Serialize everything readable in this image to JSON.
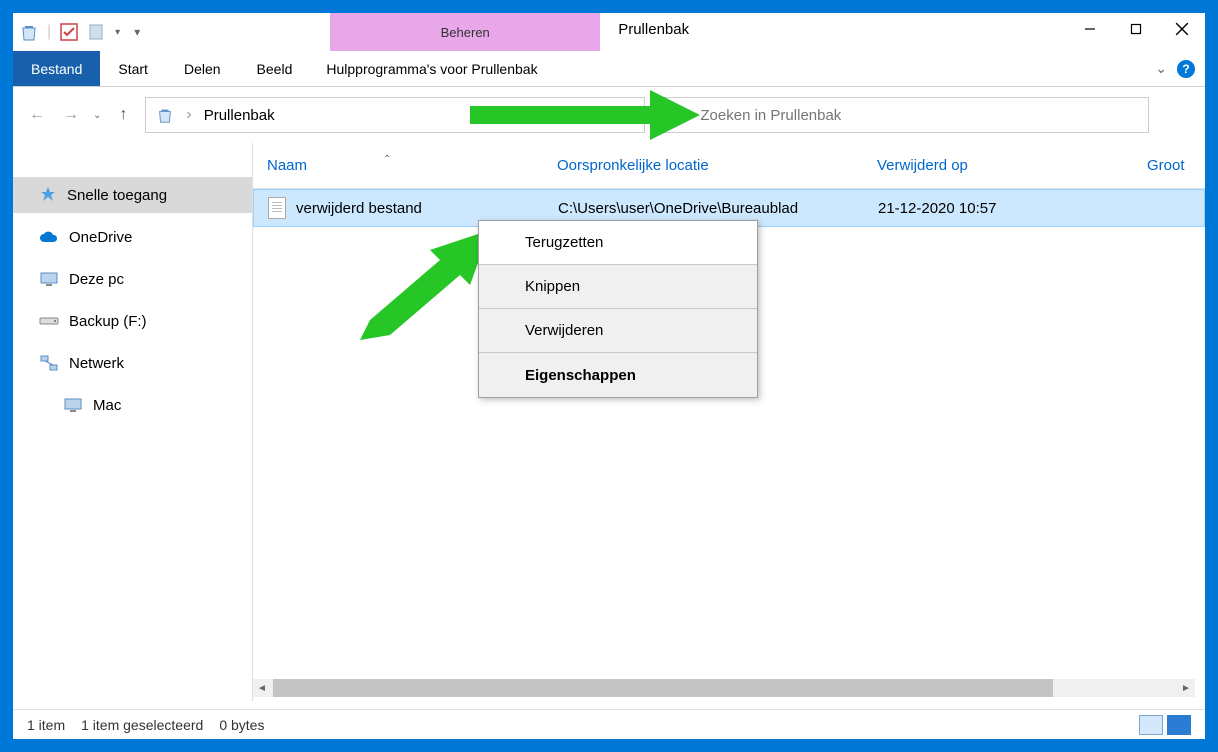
{
  "titlebar": {
    "contextual_label": "Beheren",
    "window_title": "Prullenbak"
  },
  "ribbon": {
    "file": "Bestand",
    "tabs": [
      "Start",
      "Delen",
      "Beeld",
      "Hulpprogramma's voor Prullenbak"
    ]
  },
  "address": {
    "path": "Prullenbak"
  },
  "search": {
    "placeholder": "Zoeken in Prullenbak"
  },
  "sidebar": {
    "items": [
      {
        "label": "Snelle toegang",
        "icon": "star"
      },
      {
        "label": "OneDrive",
        "icon": "cloud"
      },
      {
        "label": "Deze pc",
        "icon": "pc"
      },
      {
        "label": "Backup (F:)",
        "icon": "drive"
      },
      {
        "label": "Netwerk",
        "icon": "network"
      },
      {
        "label": "Mac",
        "icon": "pc"
      }
    ]
  },
  "columns": {
    "name": "Naam",
    "location": "Oorspronkelijke locatie",
    "deleted": "Verwijderd op",
    "size": "Groot"
  },
  "files": [
    {
      "name": "verwijderd bestand",
      "location": "C:\\Users\\user\\OneDrive\\Bureaublad",
      "deleted": "21-12-2020 10:57"
    }
  ],
  "context_menu": {
    "items": [
      "Terugzetten",
      "Knippen",
      "Verwijderen",
      "Eigenschappen"
    ]
  },
  "statusbar": {
    "count": "1 item",
    "selected": "1 item geselecteerd",
    "size": "0 bytes"
  }
}
